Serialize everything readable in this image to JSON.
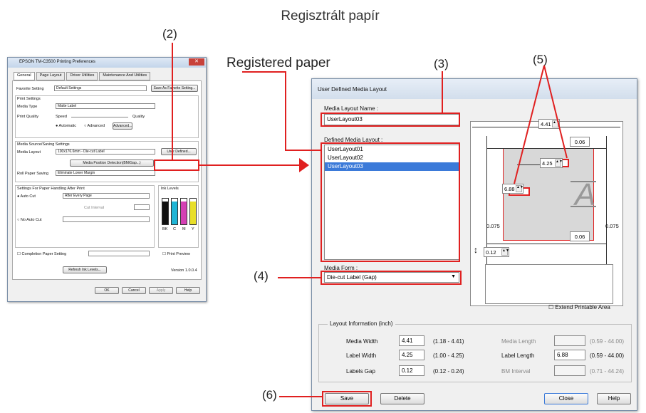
{
  "caption": "Regisztrált papír",
  "registered_label": "Registered paper",
  "callouts": {
    "c2": "(2)",
    "c3": "(3)",
    "c4": "(4)",
    "c5": "(5)",
    "c6": "(6)"
  },
  "small_dialog": {
    "title": "EPSON TM-C3500 Printing Preferences",
    "tabs": [
      "General",
      "Page Layout",
      "Driver Utilities",
      "Maintenance And Utilities"
    ],
    "favorite_label": "Favorite Setting",
    "favorite_value": "Default Settings",
    "save_favorite": "Save As Favorite Setting...",
    "print_settings": "Print Settings",
    "media_type_label": "Media Type",
    "media_type_value": "Matte Label",
    "print_quality_label": "Print Quality",
    "speed": "Speed",
    "quality": "Quality",
    "automatic": "Automatic",
    "advanced": "Advanced",
    "advanced_btn": "Advanced...",
    "media_source_group": "Media Source/Saving Settings",
    "media_layout_label": "Media Layout",
    "media_layout_value": "100x176.6mm - Die-cut Label",
    "user_defined_btn": "User Defined...",
    "detect_btn": "Media Position Detection(BM/Gap...)",
    "roll_paper_label": "Roll Paper Saving",
    "roll_paper_value": "Eliminate Lower Margin",
    "cut_group": "Settings For Paper Handling After Print",
    "auto_cut": "Auto Cut",
    "auto_cut_value": "After Every Page",
    "cut_interval": "Cut Interval",
    "no_auto_cut": "No Auto Cut",
    "ink_levels": "Ink Levels",
    "ink_labels": [
      "BK",
      "C",
      "M",
      "Y"
    ],
    "completion_paper": "Completion Paper Setting",
    "print_preview": "Print Preview",
    "refresh_btn": "Refresh Ink Levels...",
    "version": "Version 1.0.0.4",
    "ok": "OK",
    "cancel": "Cancel",
    "apply": "Apply",
    "help": "Help"
  },
  "main_dialog": {
    "title": "User Defined Media Layout",
    "layout_name_label": "Media Layout Name :",
    "layout_name_value": "UserLayout03",
    "defined_label": "Defined Media Layout :",
    "layouts": [
      "UserLayout01",
      "UserLayout02",
      "UserLayout03"
    ],
    "media_form_label": "Media Form :",
    "media_form_value": "Die-cut Label (Gap)",
    "extend_label": "Extend Printable Area",
    "layout_info_label": "Layout Information (inch)",
    "media_width_label": "Media Width",
    "media_width_value": "4.41",
    "media_width_range": "(1.18 - 4.41)",
    "label_width_label": "Label Width",
    "label_width_value": "4.25",
    "label_width_range": "(1.00 - 4.25)",
    "labels_gap_label": "Labels Gap",
    "labels_gap_value": "0.12",
    "labels_gap_range": "(0.12 - 0.24)",
    "media_length_label": "Media Length",
    "media_length_range": "(0.59 - 44.00)",
    "label_length_label": "Label Length",
    "label_length_value": "6.88",
    "label_length_range": "(0.59 - 44.00)",
    "bm_interval_label": "BM Interval",
    "bm_interval_range": "(0.71 - 44.24)",
    "save": "Save",
    "delete": "Delete",
    "close": "Close",
    "help": "Help",
    "diagram": {
      "media_width": "4.41",
      "top_margin": "0.06",
      "label_width": "4.25",
      "label_length": "6.88",
      "left_margin": "0.075",
      "right_margin": "0.075",
      "bottom_margin": "0.06",
      "gap": "0.12"
    }
  },
  "colors": {
    "highlight": "#e02020",
    "selection": "#3b7ad9"
  }
}
